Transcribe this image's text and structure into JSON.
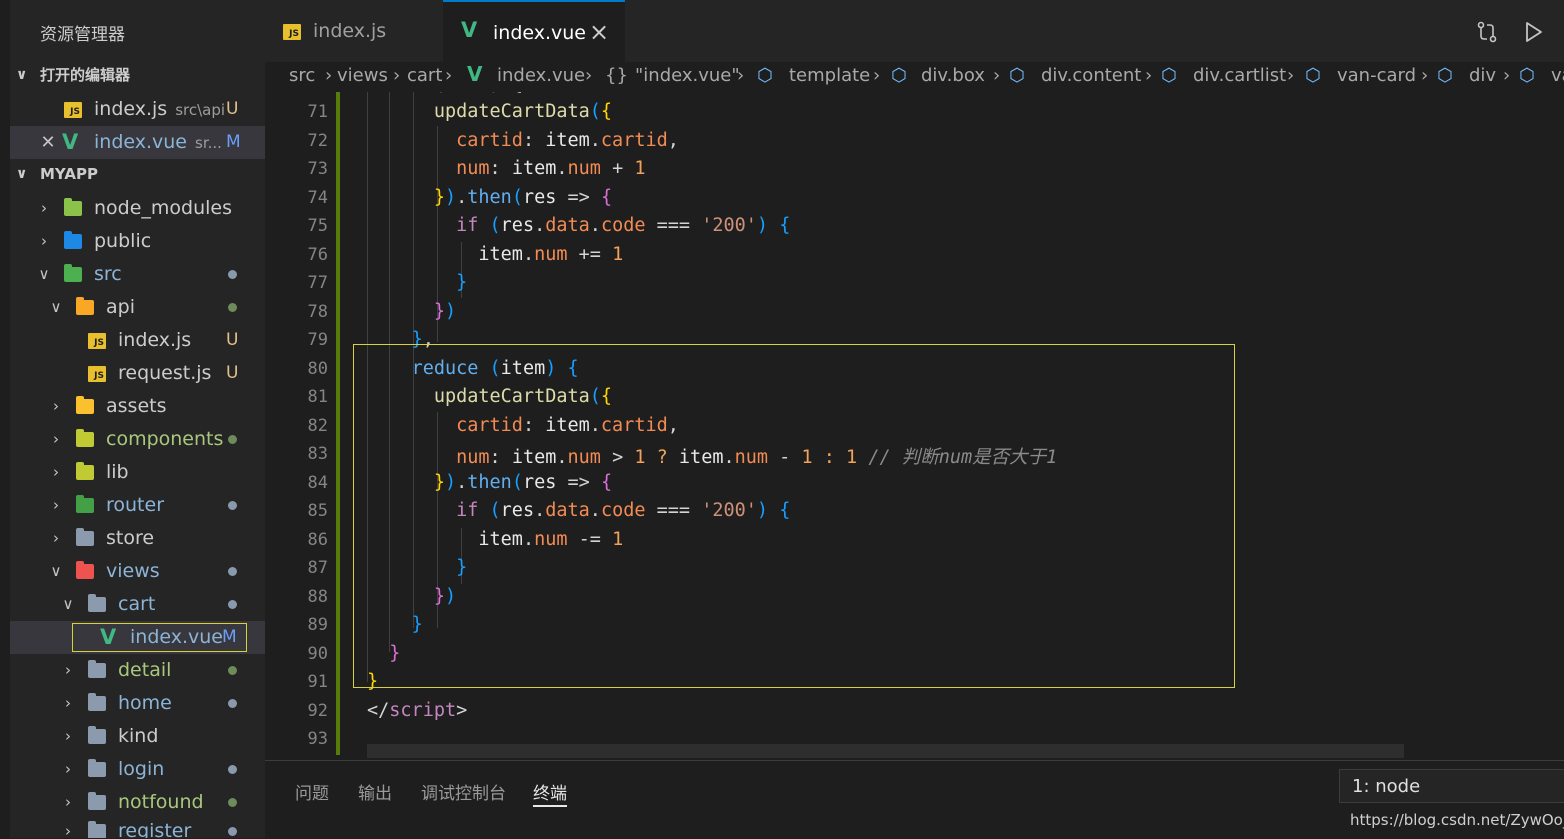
{
  "sidebar": {
    "title": "资源管理器",
    "open_editors_header": "打开的编辑器",
    "open_editors": [
      {
        "name": "index.js",
        "path": "src\\api",
        "badge": "U"
      },
      {
        "name": "index.vue",
        "path": "sr...",
        "badge": "M"
      }
    ],
    "project_header": "MYAPP",
    "tree": [
      {
        "name": "node_modules"
      },
      {
        "name": "public"
      },
      {
        "name": "src"
      },
      {
        "name": "api"
      },
      {
        "name": "index.js",
        "badge": "U"
      },
      {
        "name": "request.js",
        "badge": "U"
      },
      {
        "name": "assets"
      },
      {
        "name": "components"
      },
      {
        "name": "lib"
      },
      {
        "name": "router"
      },
      {
        "name": "store"
      },
      {
        "name": "views"
      },
      {
        "name": "cart"
      },
      {
        "name": "index.vue",
        "badge": "M"
      },
      {
        "name": "detail"
      },
      {
        "name": "home"
      },
      {
        "name": "kind"
      },
      {
        "name": "login"
      },
      {
        "name": "notfound"
      },
      {
        "name": "register"
      }
    ]
  },
  "tabs": [
    {
      "label": "index.js"
    },
    {
      "label": "index.vue"
    }
  ],
  "tab_close": "×",
  "breadcrumb": [
    "src",
    "views",
    "cart",
    "index.vue",
    "{}",
    "\"index.vue\"",
    "template",
    "div.box",
    "div.content",
    "div.cartlist",
    "van-card",
    "div",
    "va"
  ],
  "editor": {
    "line_numbers": [
      "71",
      "72",
      "73",
      "74",
      "75",
      "76",
      "77",
      "78",
      "79",
      "80",
      "81",
      "82",
      "83",
      "84",
      "85",
      "86",
      "87",
      "88",
      "89",
      "90",
      "91",
      "92",
      "93"
    ],
    "comment_83": "// 判断num是否大于1"
  },
  "panel": {
    "tabs": [
      "问题",
      "输出",
      "调试控制台",
      "终端"
    ],
    "active_tab": "终端",
    "terminal_select": "1: node"
  },
  "watermark": "https://blog.csdn.net/ZywOo_",
  "colors": {
    "accent": "#007acc",
    "highlight_box": "#d7d23a",
    "vue_green": "#41b883",
    "modified_bar": "#587c0c"
  }
}
